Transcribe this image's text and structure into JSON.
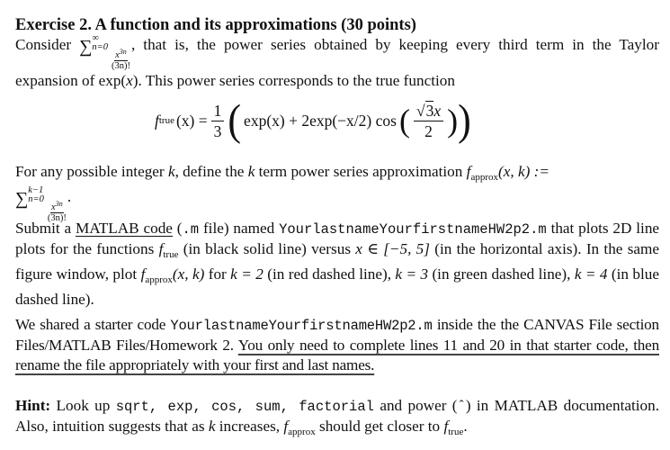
{
  "exercise": {
    "title": "Exercise 2. A function and its approximations (30 points)"
  },
  "intro": {
    "consider": "Consider",
    "sum_upper": "∞",
    "sum_lower": "n=0",
    "frac_num": "x",
    "frac_num_exp": "3n",
    "frac_den": "(3n)!",
    "text_after_sum": ", that is, the power series obtained by keeping every third term in the Taylor expansion of exp(",
    "x": "x",
    "text_end": "). This power series corresponds to the true function"
  },
  "equation": {
    "lhs_f": "f",
    "lhs_sub": "true",
    "lhs_arg": "(x) =",
    "coef_num": "1",
    "coef_den": "3",
    "term1": "exp(x) + 2exp(−x/2) cos",
    "inner_num": "3x",
    "inner_den": "2"
  },
  "approx": {
    "text1": "For any possible integer",
    "k": "k",
    "text2": ", define the",
    "text3": "term power series approximation",
    "f_sub": "approx",
    "args": "(x, k) :=",
    "sum_upper": "k−1",
    "sum_lower": "n=0",
    "frac_num": "x",
    "frac_num_exp": "3n",
    "frac_den": "(3n)!",
    "end": "."
  },
  "submit": {
    "text1": "Submit a",
    "link": "MATLAB code",
    "paren_open": " (",
    "ext": ".m",
    "text2": " file) named",
    "filename": "YourlastnameYourfirstnameHW2p2.m",
    "text3": "that plots 2D line plots for the functions",
    "f_sub_true": "true",
    "text4": " (in black solid line) versus",
    "range": "x ∈ [−5, 5]",
    "text5": " (in the horizontal axis). In the same figure window, plot",
    "f_sub_approx": "approx",
    "args": "(x, k)",
    "text6": " for",
    "k2": "k = 2",
    "text7": " (in red dashed line),",
    "k3": "k = 3",
    "text8": " (in green dashed line),",
    "k4": "k = 4",
    "text9": " (in blue dashed line)."
  },
  "shared": {
    "text1": "We shared a starter code",
    "filename": "YourlastnameYourfirstnameHW2p2.m",
    "text2": "inside the the CANVAS File section Files/MATLAB Files/Homework 2.",
    "underlined": "You only need to complete lines 11 and 20 in that starter code, then rename the file appropriately with your first and last names."
  },
  "hint": {
    "label": "Hint:",
    "text1": "Look up",
    "funcs": "sqrt, exp, cos, sum, factorial",
    "text2": "and power (",
    "caret": "ˆ",
    "text3": ") in MATLAB documentation. Also, intuition suggests that as",
    "k": "k",
    "text4": "increases,",
    "f_sub_approx": "approx",
    "text5": "should get closer to",
    "f_sub_true": "true",
    "end": "."
  }
}
